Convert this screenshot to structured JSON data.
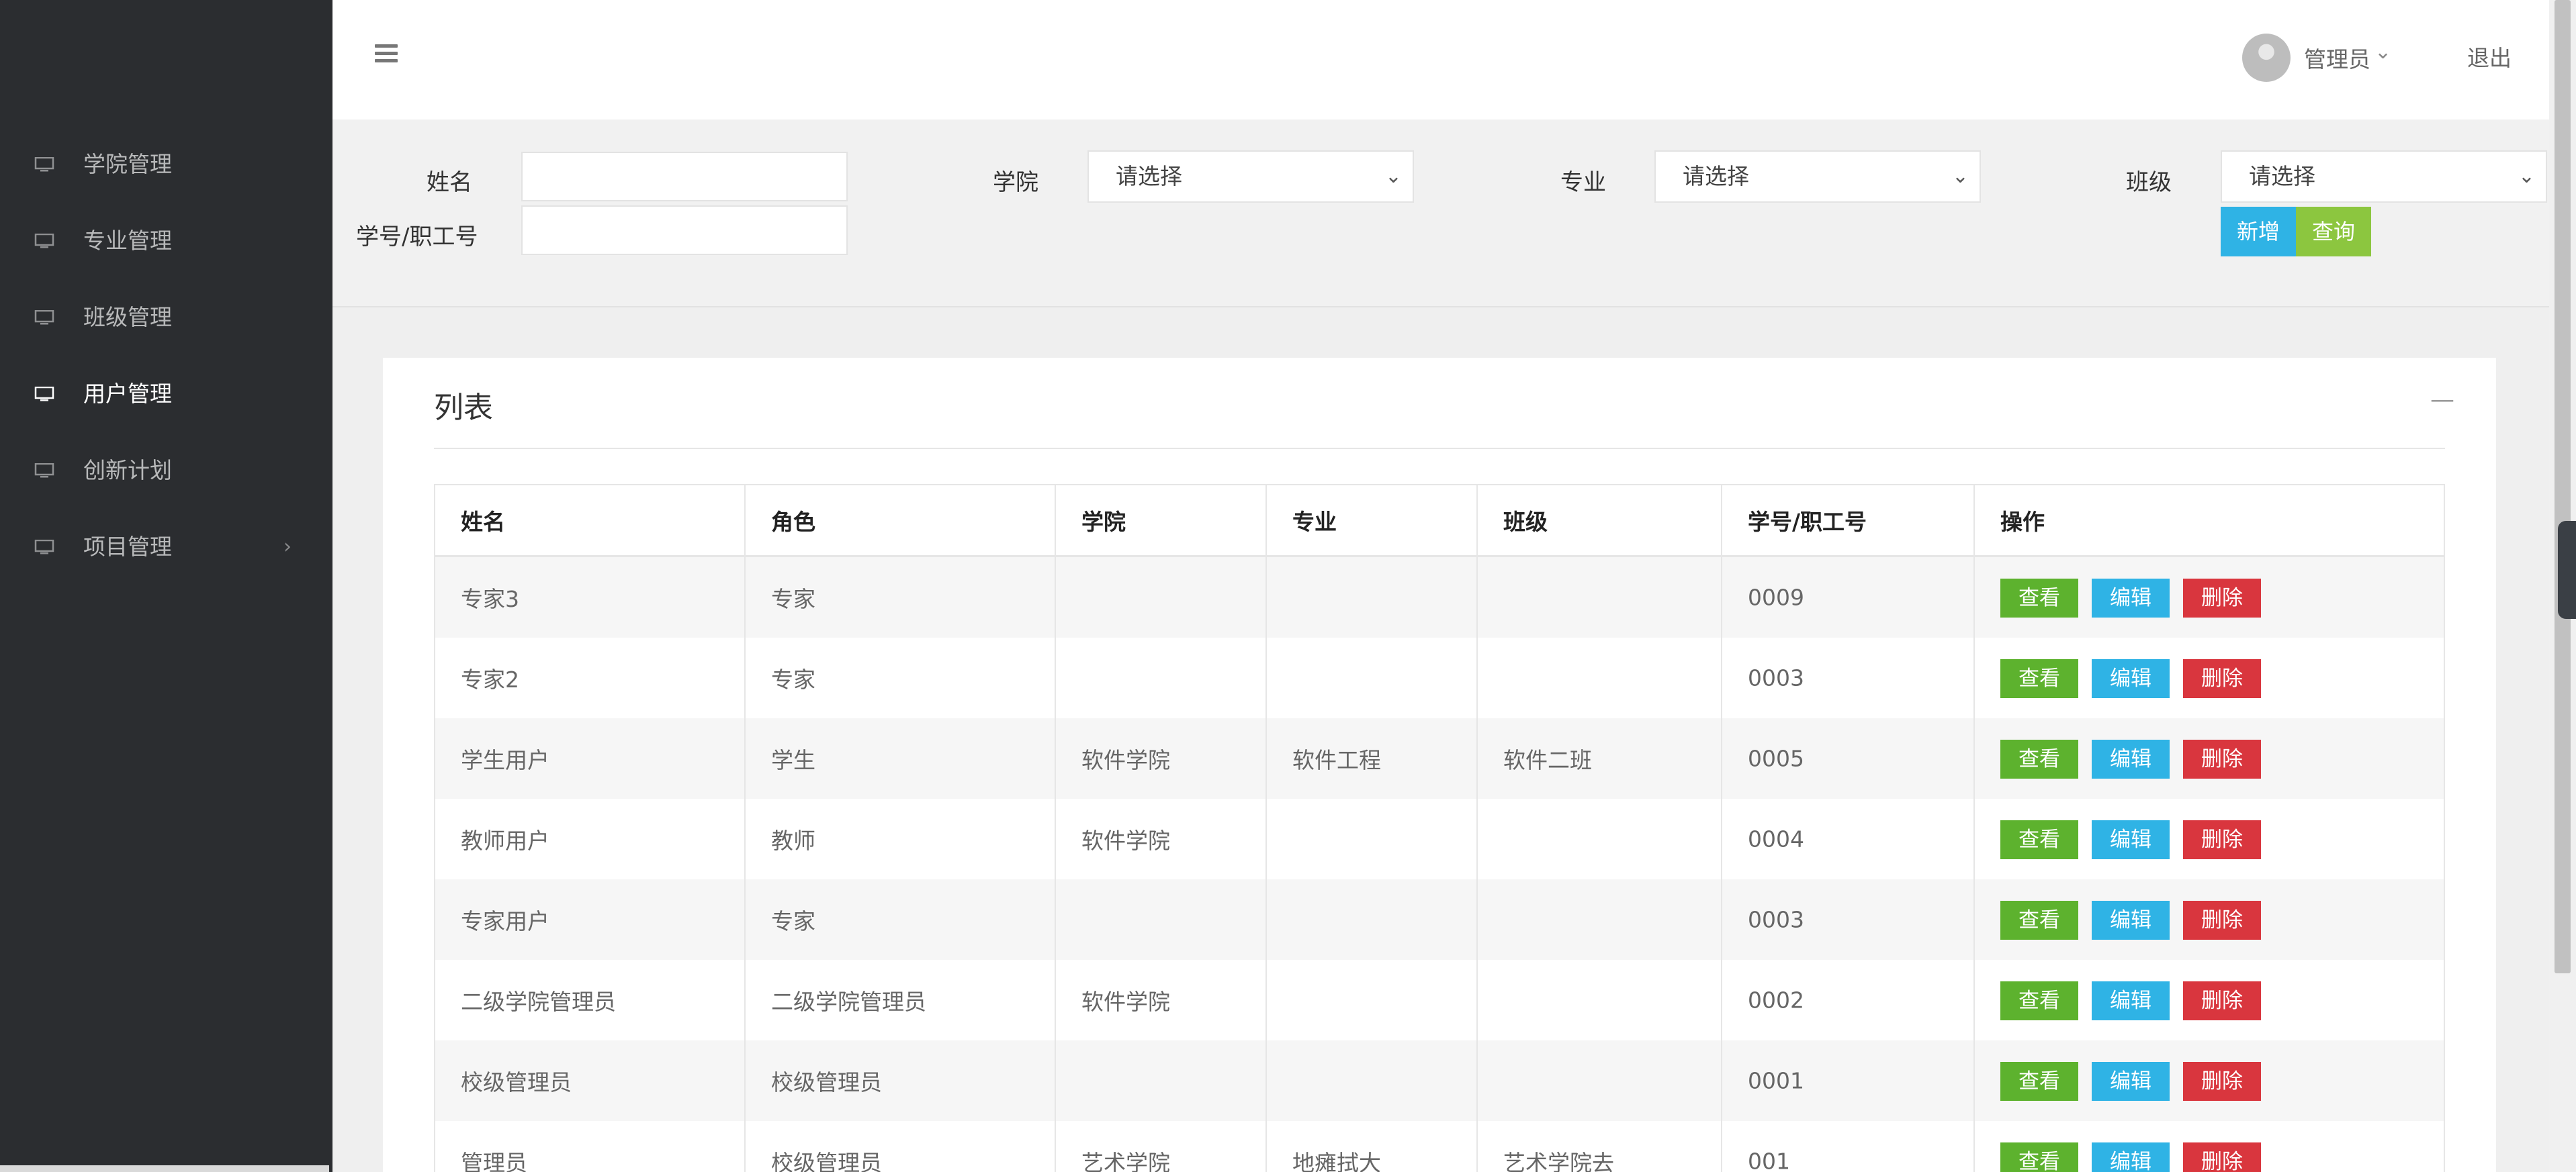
{
  "sidebar": {
    "items": [
      {
        "label": "学院管理",
        "icon": "monitor-icon",
        "active": false
      },
      {
        "label": "专业管理",
        "icon": "monitor-icon",
        "active": false
      },
      {
        "label": "班级管理",
        "icon": "monitor-icon",
        "active": false
      },
      {
        "label": "用户管理",
        "icon": "monitor-icon",
        "active": true
      },
      {
        "label": "创新计划",
        "icon": "monitor-icon",
        "active": false
      },
      {
        "label": "项目管理",
        "icon": "monitor-icon",
        "active": false,
        "has_submenu": true
      }
    ]
  },
  "header": {
    "user_name": "管理员",
    "logout_label": "退出"
  },
  "filter": {
    "name_label": "姓名",
    "name_value": "",
    "id_label": "学号/职工号",
    "id_value": "",
    "college_label": "学院",
    "college_selected": "请选择",
    "major_label": "专业",
    "major_selected": "请选择",
    "class_label": "班级",
    "class_selected": "请选择",
    "add_label": "新增",
    "query_label": "查询"
  },
  "panel": {
    "title": "列表",
    "collapse_symbol": "—"
  },
  "table": {
    "columns": [
      "姓名",
      "角色",
      "学院",
      "专业",
      "班级",
      "学号/职工号",
      "操作"
    ],
    "actions": {
      "view": "查看",
      "edit": "编辑",
      "delete": "删除"
    },
    "rows": [
      {
        "name": "专家3",
        "role": "专家",
        "college": "",
        "major": "",
        "class": "",
        "id": "0009"
      },
      {
        "name": "专家2",
        "role": "专家",
        "college": "",
        "major": "",
        "class": "",
        "id": "0003"
      },
      {
        "name": "学生用户",
        "role": "学生",
        "college": "软件学院",
        "major": "软件工程",
        "class": "软件二班",
        "id": "0005"
      },
      {
        "name": "教师用户",
        "role": "教师",
        "college": "软件学院",
        "major": "",
        "class": "",
        "id": "0004"
      },
      {
        "name": "专家用户",
        "role": "专家",
        "college": "",
        "major": "",
        "class": "",
        "id": "0003"
      },
      {
        "name": "二级学院管理员",
        "role": "二级学院管理员",
        "college": "软件学院",
        "major": "",
        "class": "",
        "id": "0002"
      },
      {
        "name": "校级管理员",
        "role": "校级管理员",
        "college": "",
        "major": "",
        "class": "",
        "id": "0001"
      },
      {
        "name": "管理员",
        "role": "校级管理员",
        "college": "艺术学院",
        "major": "地瘫拭大",
        "class": "艺术学院去",
        "id": "001"
      }
    ]
  },
  "colors": {
    "sidebar_bg": "#2b2d30",
    "add_button": "#2fb3e5",
    "query_button": "#8cc63f",
    "view_button": "#5db22e",
    "edit_button": "#2fb3e5",
    "delete_button": "#d9363e"
  }
}
